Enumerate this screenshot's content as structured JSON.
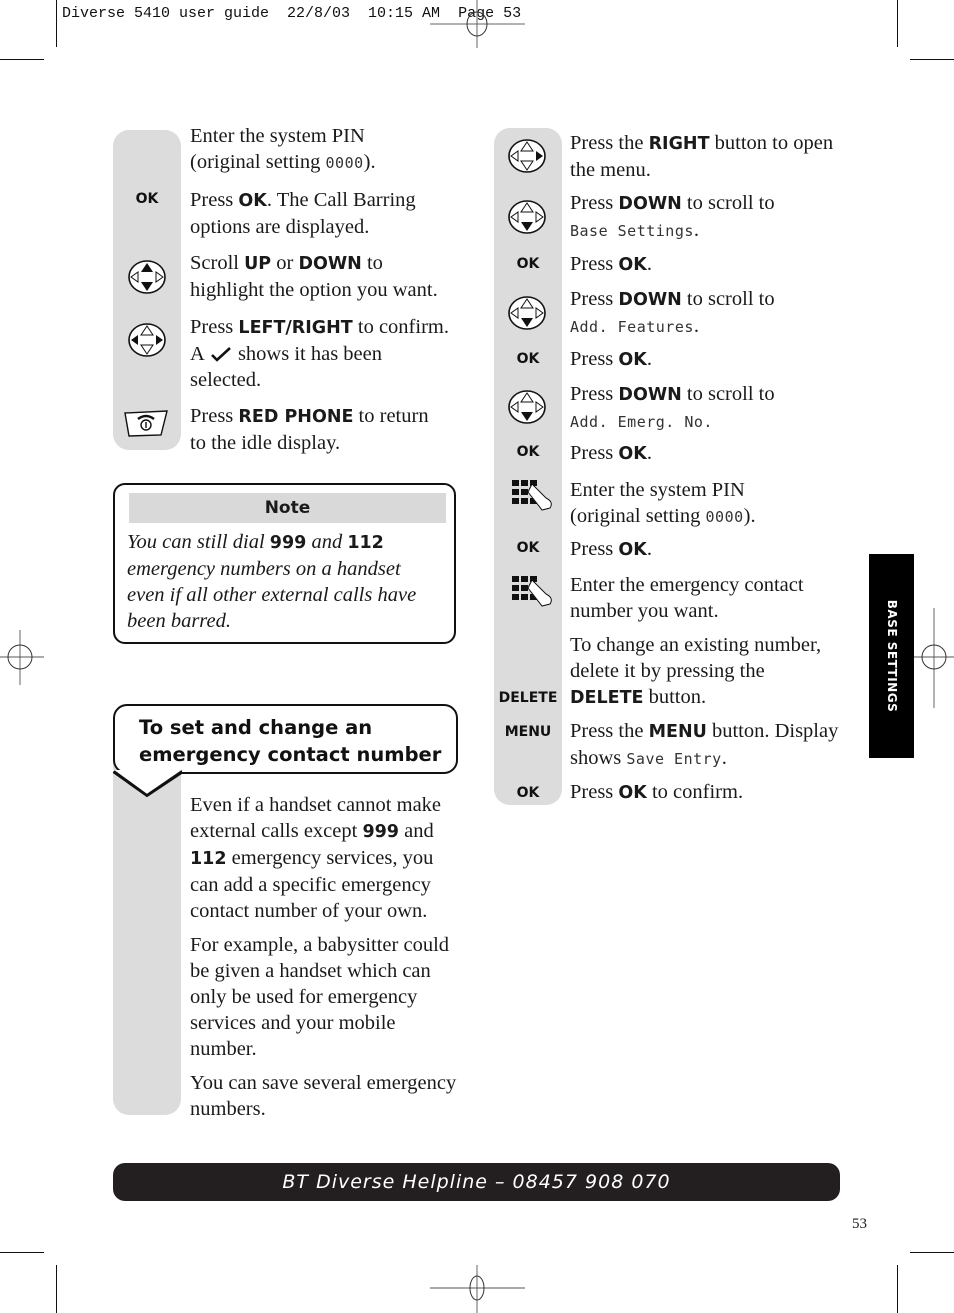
{
  "slug": "Diverse 5410 user guide  22/8/03  10:15 AM  Page 53",
  "left_steps": [
    {
      "key": "",
      "icon": "keypad-hand-icon-none",
      "text_html": "Enter the system PIN<br>(original setting <span class='lcd'>0000</span>)."
    },
    {
      "key": "OK",
      "text_html": "Press <span class='b'>OK</span>. The Call Barring options are displayed."
    },
    {
      "key": "",
      "icon": "navigation-up-down-icon",
      "text_html": "Scroll <span class='b'>UP</span> or <span class='b'>DOWN</span> to highlight the option you want."
    },
    {
      "key": "",
      "icon": "navigation-left-right-icon",
      "text_html": "Press <span class='b'>LEFT/RIGHT</span> to confirm. A ✔ shows it has been selected."
    },
    {
      "key": "",
      "icon": "red-phone-icon",
      "text_html": "Press <span class='b'>RED PHONE</span> to return to the idle display."
    }
  ],
  "left_step_texts": {
    "s0a": "Enter the system PIN",
    "s0b": "(original setting ",
    "s0pin": "0000",
    "s0c": ").",
    "s1a": "Press ",
    "s1key": "OK",
    "s1b": ". The Call Barring",
    "s1c": "options are displayed.",
    "s2a": "Scroll ",
    "s2up": "UP",
    "s2or": " or ",
    "s2down": "DOWN",
    "s2b": " to",
    "s2c": "highlight the option you want.",
    "s3a": "Press ",
    "s3key": "LEFT/RIGHT",
    "s3b": " to confirm.",
    "s3c": "A ",
    "s3d": " shows it has been",
    "s3e": "selected.",
    "s4a": "Press ",
    "s4key": "RED PHONE",
    "s4b": " to return",
    "s4c": "to the idle display."
  },
  "ok_label": "OK",
  "note": {
    "title": "Note",
    "l1a": "You can still dial ",
    "n999": "999",
    "and": " and ",
    "n112": "112",
    "l2": "emergency numbers on a handset",
    "l3": "even if all other external calls have",
    "l4": "been barred."
  },
  "section": {
    "title_l1": "To set and change an",
    "title_l2": "emergency contact number",
    "p1_l1": "Even if a handset cannot make",
    "p1_l2a": "external calls except ",
    "p1_999": "999",
    "p1_l2b": " and",
    "p1_112": "112",
    "p1_l3": " emergency services, you",
    "p1_l4": "can add a specific emergency",
    "p1_l5": "contact number of your own.",
    "p2_l1": "For example, a babysitter could",
    "p2_l2": "be given a handset which can",
    "p2_l3": "only be used for emergency",
    "p2_l4": "services and your mobile",
    "p2_l5": "number.",
    "p3_l1": "You can save several emergency",
    "p3_l2": "numbers."
  },
  "right": {
    "r1a": "Press the ",
    "r1key": "RIGHT",
    "r1b": " button to open",
    "r1c": "the menu.",
    "press_down": "Press ",
    "down": "DOWN",
    "scroll_to": " to scroll to",
    "lcd_base": "Base Settings",
    "lcd_add": "Add. Features",
    "lcd_emerg": "Add. Emerg. No.",
    "press": "Press ",
    "ok": "OK",
    "dot": ".",
    "pin_a": "Enter the system PIN",
    "pin_b": "(original setting ",
    "pin": "0000",
    "pin_c": ").",
    "enter_a": "Enter the emergency contact",
    "enter_b": "number you want.",
    "change_a": "To change an existing number,",
    "change_b": "delete it by pressing the",
    "delete": "DELETE",
    "change_c": " button.",
    "delete_key": "DELETE",
    "menu_key": "MENU",
    "menu_a": "Press the ",
    "menu": "MENU",
    "menu_b": " button. Display",
    "menu_c": "shows ",
    "lcd_save": "Save Entry",
    "confirm_a": "Press ",
    "confirm_b": " to confirm."
  },
  "side_tab": "BASE SETTINGS",
  "helpline": "BT Diverse Helpline – 08457 908 070",
  "page_number": "53"
}
